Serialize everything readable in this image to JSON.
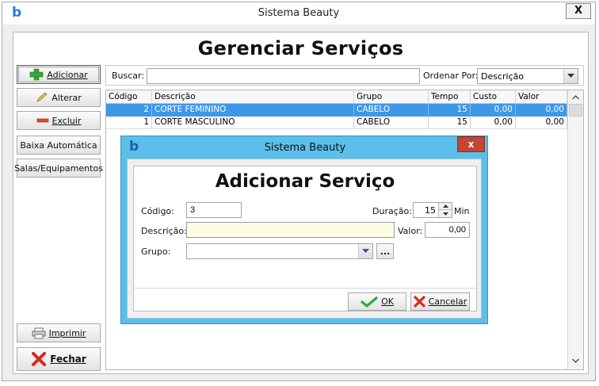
{
  "window": {
    "title": "Sistema Beauty",
    "logo": "b",
    "close": "X"
  },
  "header": {
    "title": "Gerenciar Serviços"
  },
  "sidebar": {
    "add": "Adicionar",
    "edit": "Alterar",
    "delete": "Excluir",
    "auto": "Baixa Automática",
    "rooms": "Salas/Equipamentos",
    "print": "Imprimir",
    "close": "Fechar"
  },
  "search": {
    "label": "Buscar:",
    "value": "",
    "order_label": "Ordenar Por:",
    "order_value": "Descrição"
  },
  "grid": {
    "columns": [
      "Código",
      "Descrição",
      "Grupo",
      "Tempo",
      "Custo",
      "Valor"
    ],
    "rows": [
      {
        "codigo": "2",
        "descricao": "CORTE FEMININO",
        "grupo": "CABELO",
        "tempo": "15",
        "custo": "0,00",
        "valor": "0,00"
      },
      {
        "codigo": "1",
        "descricao": "CORTE MASCULINO",
        "grupo": "CABELO",
        "tempo": "15",
        "custo": "0,00",
        "valor": "0,00"
      }
    ]
  },
  "dialog": {
    "window_title": "Sistema Beauty",
    "logo": "b",
    "close": "x",
    "title": "Adicionar Serviço",
    "codigo_label": "Código:",
    "codigo_value": "3",
    "duracao_label": "Duração:",
    "duracao_value": "15",
    "duracao_unit": "Min",
    "descricao_label": "Descrição:",
    "descricao_value": "",
    "valor_label": "Valor:",
    "valor_value": "0,00",
    "grupo_label": "Grupo:",
    "grupo_value": "",
    "browse": "...",
    "ok": "OK",
    "cancel": "Cancelar"
  },
  "colors": {
    "selection": "#3f97e8",
    "dialog_frame": "#5bbfe9",
    "description_field": "#fdfde3",
    "close_red": "#c64434"
  },
  "icons": {
    "add": "plus-icon",
    "edit": "pencil-icon",
    "delete": "minus-icon",
    "print": "printer-icon",
    "close": "red-x-icon",
    "ok": "check-icon",
    "cancel": "red-x-icon"
  }
}
